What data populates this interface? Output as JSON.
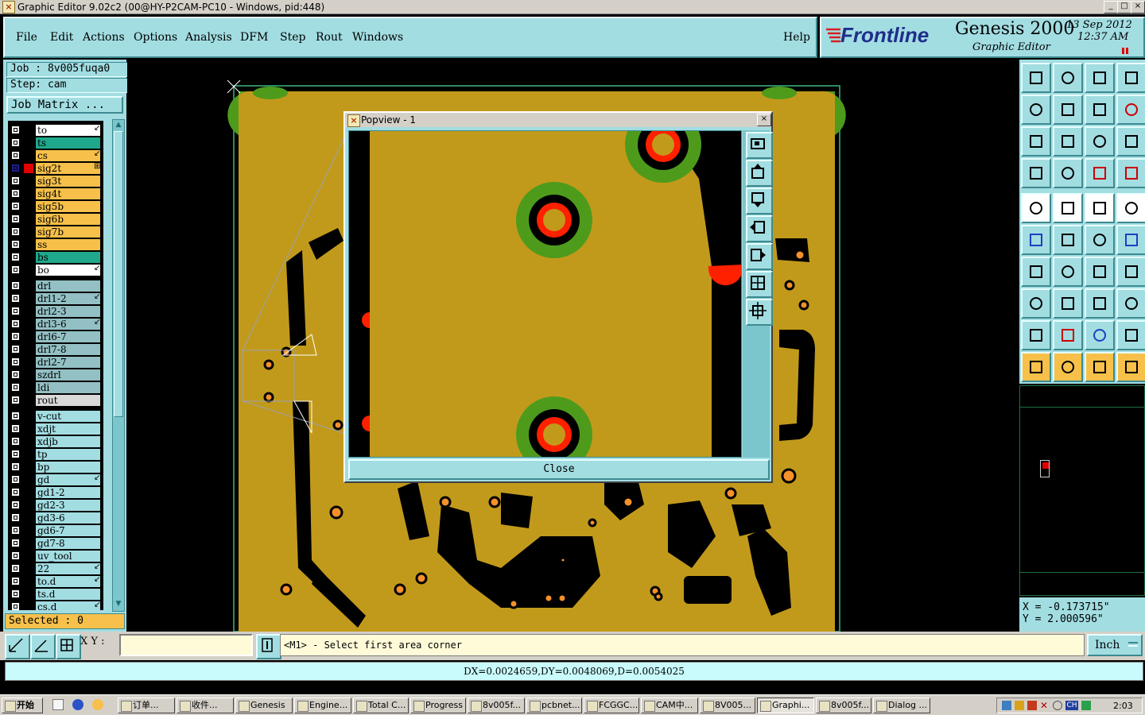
{
  "window": {
    "title": "Graphic Editor 9.02c2 (00@HY-P2CAM-PC10 - Windows, pid:448)"
  },
  "menu": [
    "File",
    "Edit",
    "Actions",
    "Options",
    "Analysis",
    "DFM",
    "Step",
    "Rout",
    "Windows"
  ],
  "help_label": "Help",
  "brand": {
    "logo": "Frontline",
    "product": "Genesis 2000",
    "subtitle": "Graphic Editor",
    "date": "13 Sep 2012",
    "time": "12:37 AM"
  },
  "job": {
    "job_line": "Job : 8v005fuqa0",
    "step_line": "Step: cam",
    "matrix_button": "Job Matrix ..."
  },
  "layers": [
    {
      "name": "to",
      "color": "#ffffff",
      "marker": "↙"
    },
    {
      "name": "ts",
      "color": "#1fa88c",
      "marker": ""
    },
    {
      "name": "cs",
      "color": "#f6c04a",
      "marker": "↙"
    },
    {
      "name": "sig2t",
      "color": "#f6c04a",
      "marker": "⊞",
      "active": true
    },
    {
      "name": "sig3t",
      "color": "#f6c04a",
      "marker": ""
    },
    {
      "name": "sig4t",
      "color": "#f6c04a",
      "marker": ""
    },
    {
      "name": "sig5b",
      "color": "#f6c04a",
      "marker": ""
    },
    {
      "name": "sig6b",
      "color": "#f6c04a",
      "marker": ""
    },
    {
      "name": "sig7b",
      "color": "#f6c04a",
      "marker": ""
    },
    {
      "name": "ss",
      "color": "#f6c04a",
      "marker": ""
    },
    {
      "name": "bs",
      "color": "#1fa88c",
      "marker": ""
    },
    {
      "name": "bo",
      "color": "#ffffff",
      "marker": "↙"
    },
    {
      "name": "drl",
      "color": "#93c0c4",
      "marker": "",
      "gap": true
    },
    {
      "name": "drl1-2",
      "color": "#93c0c4",
      "marker": "↙"
    },
    {
      "name": "drl2-3",
      "color": "#93c0c4",
      "marker": ""
    },
    {
      "name": "drl3-6",
      "color": "#93c0c4",
      "marker": "↙"
    },
    {
      "name": "drl6-7",
      "color": "#93c0c4",
      "marker": ""
    },
    {
      "name": "drl7-8",
      "color": "#93c0c4",
      "marker": ""
    },
    {
      "name": "drl2-7",
      "color": "#93c0c4",
      "marker": ""
    },
    {
      "name": "szdrl",
      "color": "#93c0c4",
      "marker": ""
    },
    {
      "name": "ldi",
      "color": "#93c0c4",
      "marker": ""
    },
    {
      "name": "rout",
      "color": "#d9d9d9",
      "marker": ""
    },
    {
      "name": "v-cut",
      "color": "#a2dde2",
      "marker": "",
      "gap": true
    },
    {
      "name": "xdjt",
      "color": "#a2dde2",
      "marker": ""
    },
    {
      "name": "xdjb",
      "color": "#a2dde2",
      "marker": ""
    },
    {
      "name": "tp",
      "color": "#a2dde2",
      "marker": ""
    },
    {
      "name": "bp",
      "color": "#a2dde2",
      "marker": ""
    },
    {
      "name": "gd",
      "color": "#a2dde2",
      "marker": "↙"
    },
    {
      "name": "gd1-2",
      "color": "#a2dde2",
      "marker": ""
    },
    {
      "name": "gd2-3",
      "color": "#a2dde2",
      "marker": ""
    },
    {
      "name": "gd3-6",
      "color": "#a2dde2",
      "marker": ""
    },
    {
      "name": "gd6-7",
      "color": "#a2dde2",
      "marker": ""
    },
    {
      "name": "gd7-8",
      "color": "#a2dde2",
      "marker": ""
    },
    {
      "name": "uv_tool",
      "color": "#a2dde2",
      "marker": ""
    },
    {
      "name": "22",
      "color": "#a2dde2",
      "marker": "↙"
    },
    {
      "name": "to.d",
      "color": "#a2dde2",
      "marker": "↙"
    },
    {
      "name": "ts.d",
      "color": "#a2dde2",
      "marker": ""
    },
    {
      "name": "cs.d",
      "color": "#a2dde2",
      "marker": "↙"
    }
  ],
  "selected_label": "Selected : 0",
  "popview": {
    "title": "Popview - 1",
    "close_label": "Close"
  },
  "coords": {
    "x_line": "X = -0.173715\"",
    "y_line": "Y = 2.000596\""
  },
  "command": {
    "xy_label": "X Y :",
    "xy_value": "",
    "prompt": "<M1> - Select first area corner",
    "units": "Inch"
  },
  "measure": "DX=0.0024659,DY=0.0048069,D=0.0054025",
  "taskbar": {
    "start": "开始",
    "tasks": [
      "订单...",
      "收件...",
      "Genesis",
      "Engine...",
      "Total C...",
      "Progress",
      "8v005f...",
      "pcbnet...",
      "FCGGC...",
      "CAM中...",
      "8V005...",
      "Graphi...",
      "8v005f...",
      "Dialog ..."
    ],
    "active_task": "Graphi...",
    "clock": "2:03"
  },
  "colors": {
    "panel": "#a2dde2",
    "board": "#c29a1b",
    "pad_green": "#4e9b1c",
    "pad_red": "#ff2000",
    "signal": "#f6c04a"
  }
}
